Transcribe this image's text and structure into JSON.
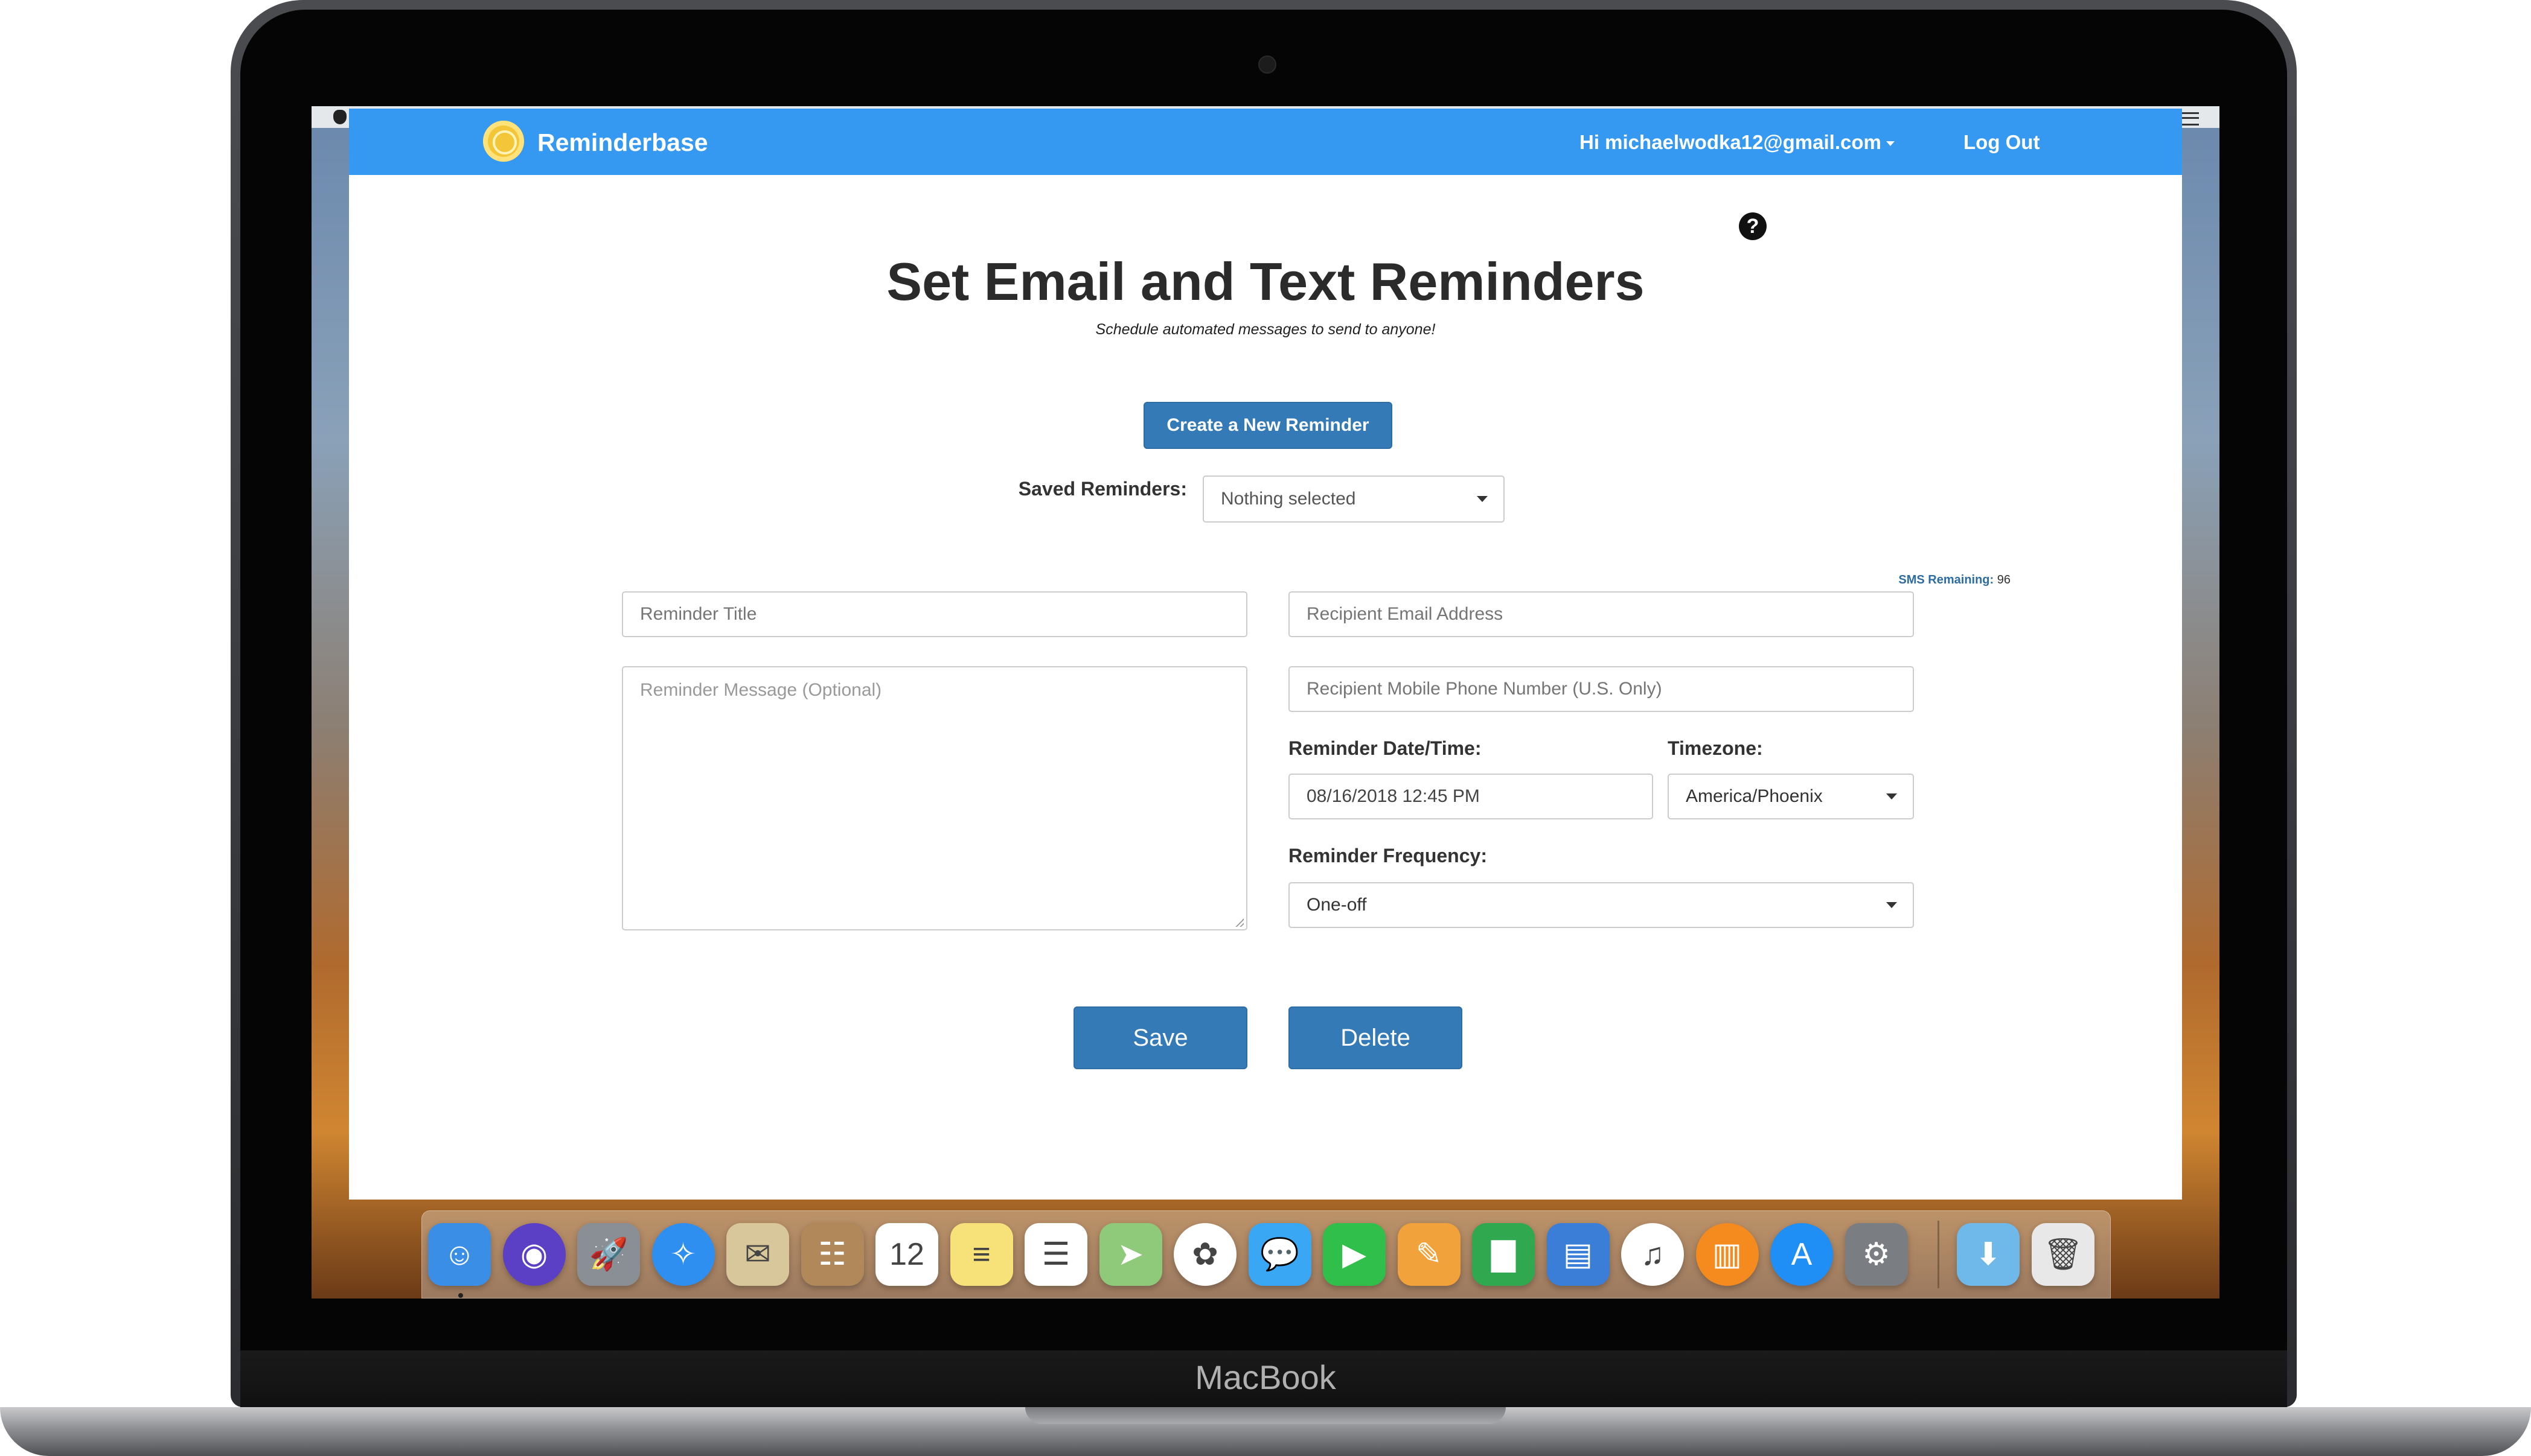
{
  "device": {
    "label": "MacBook"
  },
  "navbar": {
    "brand": "Reminderbase",
    "user_greeting": "Hi michaelwodka12@gmail.com",
    "logout": "Log Out",
    "color": "#3598f1"
  },
  "header": {
    "title": "Set Email and Text Reminders",
    "subtitle": "Schedule automated messages to send to anyone!"
  },
  "actions": {
    "create_label": "Create a New Reminder",
    "save_label": "Save",
    "delete_label": "Delete",
    "button_color": "#337ab7"
  },
  "saved": {
    "label": "Saved Reminders:",
    "selected": "Nothing selected"
  },
  "sms": {
    "label": "SMS Remaining:",
    "count": "96"
  },
  "form": {
    "title_placeholder": "Reminder Title",
    "message_placeholder": "Reminder Message (Optional)",
    "email_placeholder": "Recipient Email Address",
    "phone_placeholder": "Recipient Mobile Phone Number (U.S. Only)",
    "date_label": "Reminder Date/Time:",
    "date_value": "08/16/2018 12:45 PM",
    "timezone_label": "Timezone:",
    "timezone_value": "America/Phoenix",
    "frequency_label": "Reminder Frequency:",
    "frequency_value": "One-off"
  },
  "dock": {
    "items": [
      {
        "name": "finder-icon",
        "glyph": "☺",
        "color": "#3a8ee6"
      },
      {
        "name": "siri-icon",
        "glyph": "◉",
        "color": "#5b3fc4"
      },
      {
        "name": "launchpad-icon",
        "glyph": "🚀",
        "color": "#8a8f96"
      },
      {
        "name": "safari-icon",
        "glyph": "✧",
        "color": "#2f8ff0"
      },
      {
        "name": "mail-icon",
        "glyph": "✉",
        "color": "#d8c79a"
      },
      {
        "name": "contacts-icon",
        "glyph": "☷",
        "color": "#b0885a"
      },
      {
        "name": "calendar-icon",
        "glyph": "12",
        "color": "#ffffff"
      },
      {
        "name": "notes-icon",
        "glyph": "≡",
        "color": "#f7e27a"
      },
      {
        "name": "reminders-icon",
        "glyph": "☰",
        "color": "#ffffff"
      },
      {
        "name": "maps-icon",
        "glyph": "➤",
        "color": "#8fc97a"
      },
      {
        "name": "photos-icon",
        "glyph": "✿",
        "color": "#ffffff"
      },
      {
        "name": "messages-icon",
        "glyph": "💬",
        "color": "#3aa7f5"
      },
      {
        "name": "facetime-icon",
        "glyph": "▶",
        "color": "#2fbf4a"
      },
      {
        "name": "pages-icon",
        "glyph": "✎",
        "color": "#f2a23a"
      },
      {
        "name": "numbers-icon",
        "glyph": "▇",
        "color": "#2fa84f"
      },
      {
        "name": "keynote-icon",
        "glyph": "▤",
        "color": "#3a7ed8"
      },
      {
        "name": "itunes-icon",
        "glyph": "♫",
        "color": "#ffffff"
      },
      {
        "name": "ibooks-icon",
        "glyph": "▥",
        "color": "#f58a1f"
      },
      {
        "name": "app-store-icon",
        "glyph": "A",
        "color": "#1f8ef5"
      },
      {
        "name": "system-preferences-icon",
        "glyph": "⚙",
        "color": "#7a7d82"
      },
      {
        "name": "downloads-folder-icon",
        "glyph": "⬇",
        "color": "#6fb8ea"
      },
      {
        "name": "trash-icon",
        "glyph": "🗑",
        "color": "#e8e8e8"
      }
    ]
  }
}
